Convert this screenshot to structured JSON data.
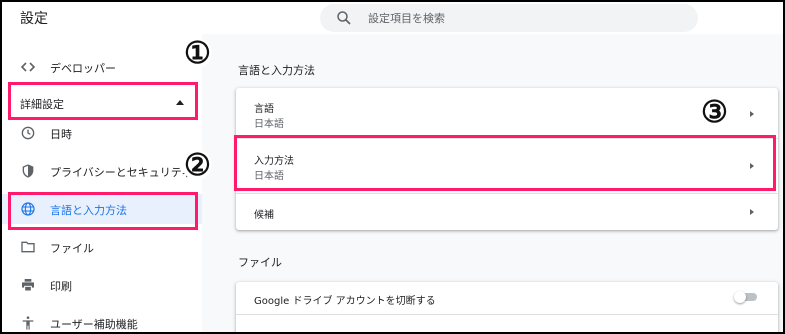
{
  "header": {
    "title": "設定",
    "search_placeholder": "設定項目を検索"
  },
  "sidebar": {
    "developer": {
      "label": "デベロッパー",
      "icon": "code-icon"
    },
    "advanced": {
      "label": "詳細設定",
      "icon": "caret-up-icon"
    },
    "items": [
      {
        "label": "日時",
        "icon": "clock-icon"
      },
      {
        "label": "プライバシーとセキュリティ",
        "icon": "shield-icon"
      },
      {
        "label": "言語と入力方法",
        "icon": "globe-icon",
        "active": true
      },
      {
        "label": "ファイル",
        "icon": "folder-icon"
      },
      {
        "label": "印刷",
        "icon": "printer-icon"
      },
      {
        "label": "ユーザー補助機能",
        "icon": "accessibility-icon"
      }
    ]
  },
  "main": {
    "section_language": "言語と入力方法",
    "rows": [
      {
        "title": "言語",
        "subtitle": "日本語"
      },
      {
        "title": "入力方法",
        "subtitle": "日本語"
      },
      {
        "title": "候補"
      }
    ],
    "section_files": "ファイル",
    "files_row": {
      "title": "Google ドライブ アカウントを切断する",
      "toggle_on": false
    }
  },
  "annotations": {
    "one": "①",
    "two": "②",
    "three": "③",
    "color": "#ff1a6b"
  },
  "colors": {
    "accent": "#1a73e8",
    "active_bg": "#e8f0fe",
    "highlight": "#ff1a6b"
  }
}
